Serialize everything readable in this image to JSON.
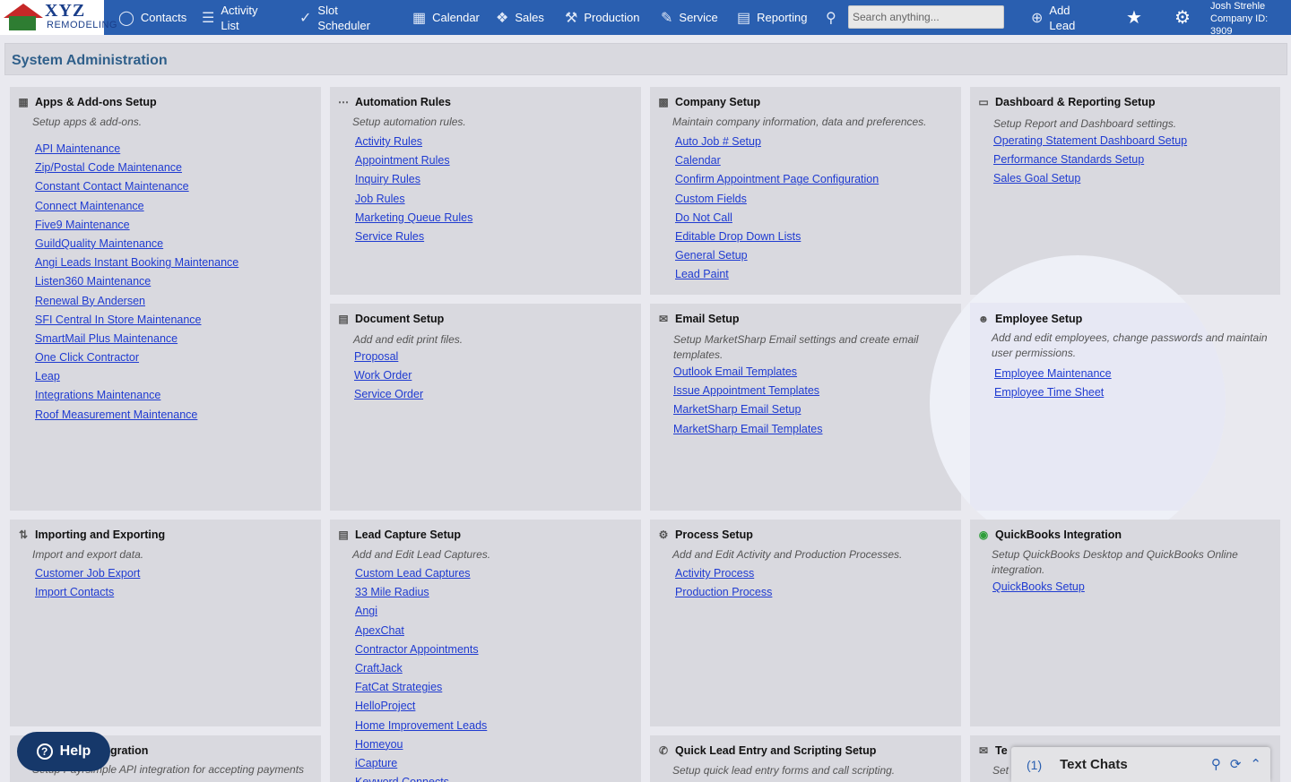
{
  "app": {
    "logo_text": "XYZ",
    "logo_sub": "REMODELING"
  },
  "nav": {
    "contacts": "Contacts",
    "activity_list": [
      "Activity",
      "List"
    ],
    "slot_scheduler": [
      "Slot",
      "Scheduler"
    ],
    "calendar": "Calendar",
    "sales": "Sales",
    "production": "Production",
    "service": "Service",
    "reporting": "Reporting",
    "search_placeholder": "Search anything...",
    "add_lead": [
      "Add",
      "Lead"
    ],
    "user_name": "Josh Strehle",
    "company_id": "Company ID: 3909"
  },
  "page": {
    "title": "System Administration"
  },
  "cards": {
    "apps": {
      "title": "Apps & Add-ons Setup",
      "desc": "Setup apps & add-ons.",
      "links": [
        "API Maintenance",
        "Zip/Postal Code Maintenance",
        "Constant Contact Maintenance",
        "Connect Maintenance",
        "Five9 Maintenance",
        "GuildQuality Maintenance",
        "Angi Leads Instant Booking Maintenance",
        "Listen360 Maintenance",
        "Renewal By Andersen",
        "SFI Central In Store Maintenance",
        "SmartMail Plus Maintenance",
        "One Click Contractor",
        "Leap",
        "Integrations Maintenance",
        "Roof Measurement Maintenance"
      ]
    },
    "automation": {
      "title": "Automation Rules",
      "desc": "Setup automation rules.",
      "links": [
        "Activity Rules",
        "Appointment Rules",
        "Inquiry Rules",
        "Job Rules",
        "Marketing Queue Rules",
        "Service Rules"
      ]
    },
    "company": {
      "title": "Company Setup",
      "desc": "Maintain company information, data and preferences.",
      "links": [
        "Auto Job # Setup",
        "Calendar",
        "Confirm Appointment Page Configuration",
        "Custom Fields",
        "Do Not Call",
        "Editable Drop Down Lists",
        "General Setup",
        "Lead Paint"
      ]
    },
    "dashboard": {
      "title": "Dashboard & Reporting Setup",
      "desc": "Setup Report and Dashboard settings.",
      "links": [
        "Operating Statement Dashboard Setup",
        "Performance Standards Setup",
        "Sales Goal Setup"
      ]
    },
    "document": {
      "title": "Document Setup",
      "desc": "Add and edit print files.",
      "links": [
        "Proposal",
        "Work Order",
        "Service Order"
      ]
    },
    "email": {
      "title": "Email Setup",
      "desc": "Setup MarketSharp Email settings and create email templates.",
      "links": [
        "Outlook Email Templates",
        "Issue Appointment Templates",
        "MarketSharp Email Setup",
        "MarketSharp Email Templates"
      ]
    },
    "employee": {
      "title": "Employee Setup",
      "desc": "Add and edit employees, change passwords and maintain user permissions.",
      "links": [
        "Employee Maintenance",
        "Employee Time Sheet"
      ]
    },
    "importing": {
      "title": "Importing and Exporting",
      "desc": "Import and export data.",
      "links": [
        "Customer Job Export",
        "Import Contacts"
      ]
    },
    "leadcapture": {
      "title": "Lead Capture Setup",
      "desc": "Add and Edit Lead Captures.",
      "links": [
        "Custom Lead Captures",
        "33 Mile Radius",
        "Angi",
        "ApexChat",
        "Contractor Appointments",
        "CraftJack",
        "FatCat Strategies",
        "HelloProject",
        "Home Improvement Leads",
        "Homeyou",
        "iCapture",
        "Keyword Connects"
      ]
    },
    "process": {
      "title": "Process Setup",
      "desc": "Add and Edit Activity and Production Processes.",
      "links": [
        "Activity Process",
        "Production Process"
      ]
    },
    "quickbooks": {
      "title": "QuickBooks Integration",
      "desc": "Setup QuickBooks Desktop and QuickBooks Online integration.",
      "links": [
        "QuickBooks Setup"
      ]
    },
    "payment": {
      "title": "gration",
      "desc": "Setup Payrsimple API integration for accepting payments"
    },
    "quicklead": {
      "title": "Quick Lead Entry and Scripting Setup",
      "desc": "Setup quick lead entry forms and call scripting."
    },
    "textpartial": {
      "title": "Te",
      "desc": "Set"
    }
  },
  "help": {
    "label": "Help"
  },
  "chats": {
    "count": "(1)",
    "label": "Text Chats"
  }
}
